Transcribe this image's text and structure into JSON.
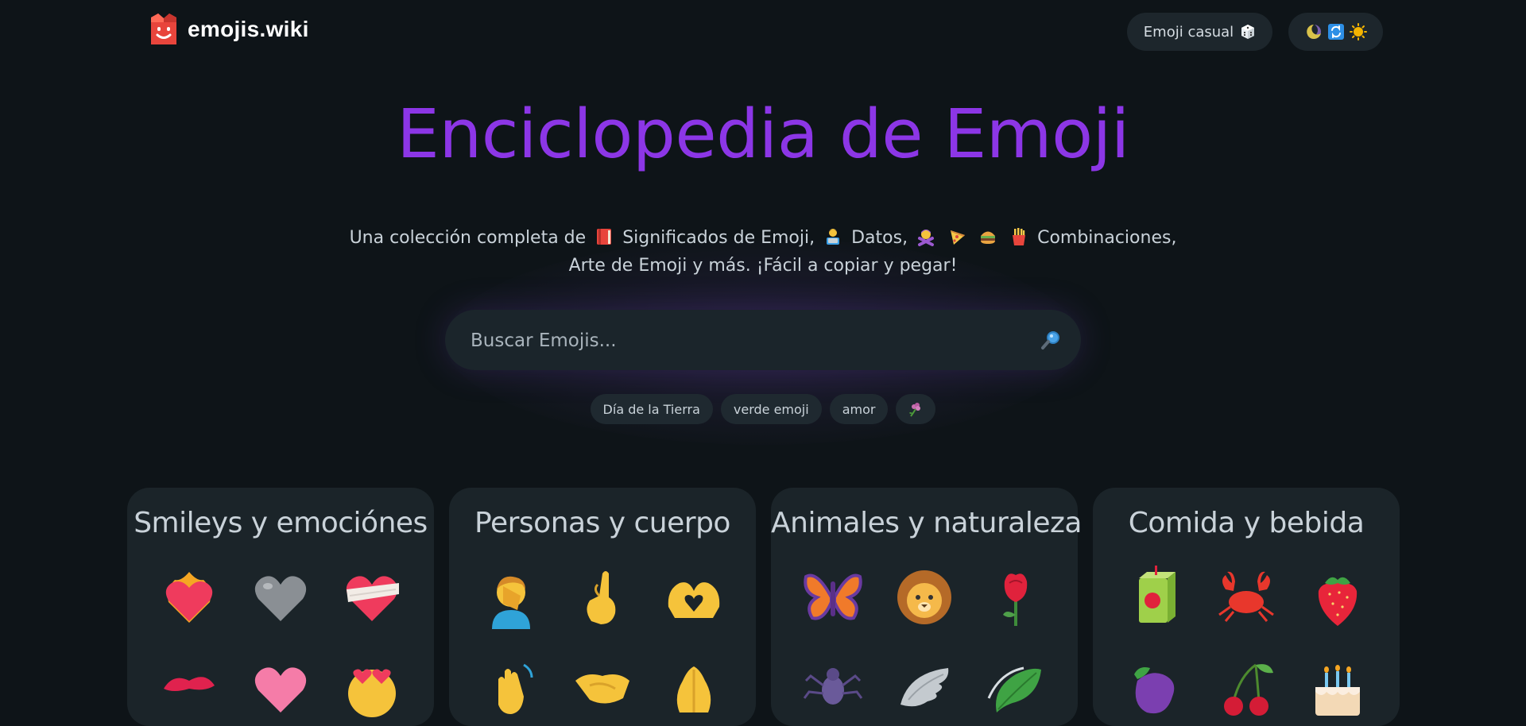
{
  "header": {
    "logo_text": "emojis.wiki",
    "random_button_label": "Emoji casual",
    "theme_icons": [
      "moon-icon",
      "auto-theme-icon",
      "sun-icon"
    ]
  },
  "hero": {
    "title": "Enciclopedia de Emoji",
    "subtitle": {
      "part1": "Una colección completa de",
      "part2": "Significados de Emoji,",
      "part3": "Datos,",
      "part4": "Combinaciones,",
      "part5": "Arte de Emoji y más. ¡Fácil a copiar y pegar!"
    },
    "title_color": "#8c36e6"
  },
  "search": {
    "placeholder": "Buscar Emojis..."
  },
  "tags": [
    "Día de la Tierra",
    "verde emoji",
    "amor"
  ],
  "categories": [
    {
      "title": "Smileys y emociónes",
      "emoji_icons": [
        "heart-on-fire-icon",
        "grey-heart-icon",
        "mending-heart-icon",
        "kiss-mark-icon",
        "pink-heart-icon",
        "heart-eyes-face-icon"
      ]
    },
    {
      "title": "Personas y cuerpo",
      "emoji_icons": [
        "man-facepalming-icon",
        "hand-with-index-finger-and-thumb-crossed-icon",
        "heart-hands-icon",
        "waving-hand-icon",
        "handshake-icon",
        "folded-hands-icon"
      ]
    },
    {
      "title": "Animales y naturaleza",
      "emoji_icons": [
        "butterfly-icon",
        "lion-icon",
        "rose-icon",
        "spider-icon",
        "wing-icon",
        "leaf-icon"
      ]
    },
    {
      "title": "Comida y bebida",
      "emoji_icons": [
        "beverage-box-icon",
        "crab-icon",
        "strawberry-icon",
        "eggplant-icon",
        "cherries-icon",
        "birthday-cake-icon"
      ]
    }
  ],
  "colors": {
    "background": "#0e1418",
    "card": "#1b2429",
    "accent": "#8c36e6"
  }
}
